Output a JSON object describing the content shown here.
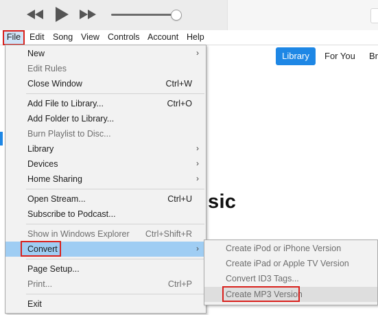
{
  "menubar": {
    "items": [
      {
        "label": "File",
        "active": true
      },
      {
        "label": "Edit"
      },
      {
        "label": "Song"
      },
      {
        "label": "View"
      },
      {
        "label": "Controls"
      },
      {
        "label": "Account"
      },
      {
        "label": "Help"
      }
    ]
  },
  "nav": {
    "library": "Library",
    "for_you": "For You",
    "browse": "Br"
  },
  "background_heading": "usic",
  "file_menu": {
    "items": [
      {
        "label": "New",
        "submenu": true
      },
      {
        "label": "Edit Rules",
        "disabled": true
      },
      {
        "label": "Close Window",
        "shortcut": "Ctrl+W"
      },
      {
        "label": "Add File to Library...",
        "shortcut": "Ctrl+O"
      },
      {
        "label": "Add Folder to Library..."
      },
      {
        "label": "Burn Playlist to Disc...",
        "disabled": true
      },
      {
        "label": "Library",
        "submenu": true
      },
      {
        "label": "Devices",
        "submenu": true
      },
      {
        "label": "Home Sharing",
        "submenu": true
      },
      {
        "label": "Open Stream...",
        "shortcut": "Ctrl+U"
      },
      {
        "label": "Subscribe to Podcast..."
      },
      {
        "label": "Show in Windows Explorer",
        "shortcut": "Ctrl+Shift+R",
        "disabled": true
      },
      {
        "label": "Convert",
        "submenu": true,
        "selected": true
      },
      {
        "label": "Page Setup..."
      },
      {
        "label": "Print...",
        "shortcut": "Ctrl+P",
        "disabled": true
      },
      {
        "label": "Exit"
      }
    ]
  },
  "convert_submenu": {
    "items": [
      {
        "label": "Create iPod or iPhone Version",
        "disabled": true
      },
      {
        "label": "Create iPad or Apple TV Version",
        "disabled": true
      },
      {
        "label": "Convert ID3 Tags...",
        "disabled": true
      },
      {
        "label": "Create MP3 Version",
        "disabled": true,
        "highlighted": true
      }
    ]
  },
  "colors": {
    "accent": "#1e87e5",
    "highlight_box": "#d9201c",
    "selected_row": "#9fcdf3",
    "menu_bg": "#f2f2f2"
  },
  "icons": [
    "rewind-icon",
    "play-icon",
    "fast-forward-icon",
    "submenu-arrow-icon"
  ]
}
